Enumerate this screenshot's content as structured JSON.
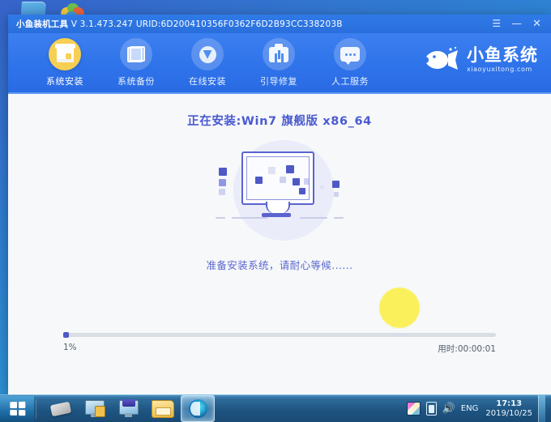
{
  "window": {
    "title_brand": "小鱼装机工具",
    "title_version": " V 3.1.473.247 URID:6D200410356F0362F6D2B93CC338203B",
    "menu_icon": "☰",
    "minimize_icon": "—",
    "close_icon": "✕"
  },
  "nav": {
    "items": [
      {
        "label": "系统安装",
        "icon": "install-box-icon",
        "active": true
      },
      {
        "label": "系统备份",
        "icon": "copy-layers-icon",
        "active": false
      },
      {
        "label": "在线安装",
        "icon": "download-arrow-icon",
        "active": false
      },
      {
        "label": "引导修复",
        "icon": "toolkit-icon",
        "active": false
      },
      {
        "label": "人工服务",
        "icon": "chat-bubble-icon",
        "active": false
      }
    ]
  },
  "logo": {
    "icon": "fish-icon",
    "name_cn": "小鱼系统",
    "name_en": "xiaoyuxitong.com"
  },
  "main": {
    "install_title": "正在安装:Win7 旗舰版 x86_64",
    "illustration": "monitor-illustration",
    "hint": "准备安装系统，请耐心等候......",
    "progress": {
      "percent_label": "1%",
      "percent_value": 1,
      "elapsed_label": "用时:00:00:01"
    }
  },
  "colors": {
    "header_blue": "#2f73ea",
    "title_blue": "#2a6fdc",
    "accent_yellow": "#f7cf53",
    "text_indigo": "#4a5bd0",
    "progress_fill": "#4f59c6",
    "cursor_highlight": "#fbf04e"
  },
  "desktop": {
    "icons": [
      {
        "label": "",
        "glyph": "folder-icon"
      },
      {
        "label": "",
        "glyph": "flower-icon"
      }
    ]
  },
  "taskbar": {
    "start_icon": "windows-start-icon",
    "items": [
      {
        "icon": "chip-icon",
        "active": false
      },
      {
        "icon": "monitor-tools-icon",
        "active": false
      },
      {
        "icon": "monitor-network-icon",
        "active": false
      },
      {
        "icon": "folder-icon",
        "active": false
      },
      {
        "icon": "edge-browser-icon",
        "active": true
      }
    ],
    "tray": {
      "color_icon": "color-palette-icon",
      "usb_icon": "usb-device-icon",
      "volume_icon": "🔊",
      "language": "ENG",
      "time": "17:13",
      "date": "2019/10/25"
    }
  }
}
